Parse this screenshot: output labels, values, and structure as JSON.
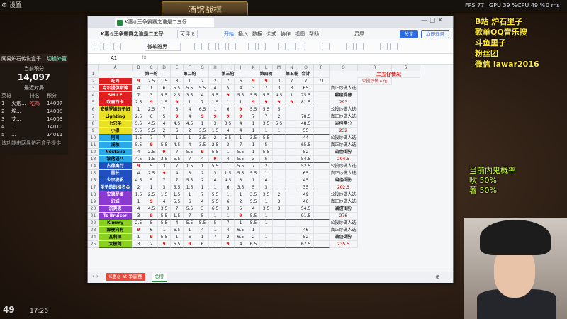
{
  "top": {
    "settings": "设置",
    "title": "酒馆战棋",
    "fps_label": "FPS",
    "fps": "77",
    "gpu_label": "GPU",
    "gpu": "39 %",
    "cpu_label": "CPU",
    "cpu": "49 %",
    "delay_label": "延迟",
    "delay": "0 ms"
  },
  "left_panel": {
    "name": "网易炉石传说盒子",
    "switch": "切换外置",
    "score_label": "当前积分",
    "score": "14,097",
    "recent": "最近对局",
    "col1": "英雄",
    "col2": "排名",
    "col3": "积分",
    "rows": [
      [
        "1",
        "火炮...",
        "吃鸡",
        "14097"
      ],
      [
        "2",
        "埃...",
        "",
        "14008"
      ],
      [
        "3",
        "艾...",
        "",
        "14003"
      ],
      [
        "4",
        "...",
        "",
        "14010"
      ],
      [
        "5",
        "...",
        "",
        "14011"
      ]
    ],
    "footer": "该功能由网易炉石盒子提供"
  },
  "window": {
    "tab": "K惠◎王争霸赛之谁是二五仔",
    "doc_title": "K惠◎王争霸赛之谁是二五仔",
    "quick_btn": "可评论",
    "menu": [
      "开始",
      "插入",
      "数据",
      "公式",
      "协作",
      "视图",
      "帮助"
    ],
    "share": "分享",
    "login": "立即登录",
    "people": "灵犀",
    "cell_ref": "A1",
    "font_name": "微软雅黑",
    "sheet_tabs": [
      "K惠◎ at 争霸赛",
      "总榜"
    ]
  },
  "grid": {
    "cols": [
      "A",
      "B",
      "C",
      "D",
      "E",
      "F",
      "G",
      "H",
      "I",
      "J",
      "K",
      "L",
      "M",
      "N",
      "O",
      "P",
      "Q",
      "R",
      "S",
      "T"
    ],
    "round_headers": [
      "第一轮",
      "第二轮",
      "第三轮",
      "第四轮",
      "第五轮",
      "合计",
      "",
      "二五仔情况"
    ],
    "rows": [
      [
        "吃鸡",
        "9",
        "2.5",
        "1.5",
        "3",
        "1",
        "2",
        "2",
        "7",
        "6",
        "9",
        "9",
        "3",
        "7",
        "7",
        "71",
        "",
        "公投炒做人选"
      ],
      [
        "克尔提伊斯钟",
        "4",
        "1",
        "6",
        "5.5",
        "5.5",
        "5.5",
        "4",
        "5",
        "4",
        "3",
        "7",
        "3",
        "3",
        "65",
        "",
        "真正炒做人选"
      ],
      [
        "SMILE",
        "7",
        "3",
        "5.5",
        "2.5",
        "3.5",
        "4",
        "5.5",
        "9",
        "5.5",
        "5.5",
        "5.5",
        "4.5",
        "1",
        "75.5",
        "",
        "最佳得分"
      ],
      [
        "吹鹿西卡",
        "2.5",
        "9",
        "1.5",
        "9",
        "1",
        "7",
        "1.5",
        "1",
        "1",
        "9",
        "9",
        "9",
        "9",
        "81.5",
        "",
        "293"
      ],
      [
        "安德罗姬的子妇",
        "1",
        "2.5",
        "7",
        "3",
        "4",
        "6.5",
        "1",
        "6",
        "9",
        "5.5",
        "5.5",
        "5",
        "",
        "",
        "",
        "公投炒做人选"
      ],
      [
        "Lighting",
        "2.5",
        "6",
        "5",
        "9",
        "4",
        "9",
        "9",
        "9",
        "9",
        "7",
        "7",
        "2",
        "",
        "78.5",
        "",
        "真正炒做人选"
      ],
      [
        "七只羊",
        "5.5",
        "4.5",
        "4",
        "4.5",
        "4.5",
        "1",
        "3",
        "3.5",
        "4",
        "1",
        "3.5",
        "5.5",
        "",
        "48.5",
        "",
        "最佳得分"
      ],
      [
        "小狼",
        "5.5",
        "5.5",
        "2",
        "6",
        "2",
        "3.5",
        "1.5",
        "4",
        "4",
        "1",
        "1",
        "1",
        "",
        "55",
        "",
        "232"
      ],
      [
        "阿司",
        "1.5",
        "7",
        "7",
        "1",
        "1",
        "3.5",
        "2",
        "5.5",
        "1",
        "3.5",
        "5.5",
        "",
        "",
        "44",
        "",
        "公投炒做人选"
      ],
      [
        "浅秋",
        "5.5",
        "9",
        "5.5",
        "4.5",
        "4",
        "3.5",
        "2.5",
        "3",
        "7",
        "1",
        "5",
        "",
        "",
        "65.5",
        "",
        "真正炒做人选"
      ],
      [
        "Nostalie",
        "4",
        "2.5",
        "9",
        "7",
        "5.5",
        "9",
        "5.5",
        "1",
        "5.5",
        "1",
        "5.5",
        "",
        "",
        "52",
        "",
        "最佳得分"
      ],
      [
        "漆落语八",
        "4.5",
        "1.5",
        "3.5",
        "5.5",
        "7",
        "4",
        "9",
        "4",
        "5.5",
        "3",
        "5",
        "",
        "",
        "54.5",
        "",
        "204.5"
      ],
      [
        "古德奥行",
        "9",
        "5",
        "3",
        "7",
        "1.5",
        "1",
        "5.5",
        "1",
        "5.5",
        "7",
        "2",
        "",
        "",
        "52.5",
        "",
        "公投炒做人选"
      ],
      [
        "雷长",
        "4",
        "2.5",
        "9",
        "4",
        "3",
        "2",
        "3",
        "1.5",
        "5.5",
        "5.5",
        "1",
        "",
        "",
        "65",
        "",
        "真正炒做人选"
      ],
      [
        "少宗祝帆",
        "4.5",
        "5",
        "7",
        "7",
        "5.5",
        "2",
        "4",
        "4.5",
        "3",
        "1",
        "4",
        "",
        "",
        "45",
        "",
        "最佳得分"
      ],
      [
        "至子的的招名金",
        "2",
        "1",
        "3",
        "5.5",
        "1.5",
        "1",
        "1",
        "6",
        "3.5",
        "5",
        "3",
        "",
        "",
        "35",
        "",
        "202.5"
      ],
      [
        "安德罗姬",
        "1.5",
        "2.5",
        "1.5",
        "1.5",
        "1",
        "7",
        "5.5",
        "1",
        "1",
        "3.5",
        "3.5",
        "2",
        "",
        "49",
        "",
        "公投炒做人选"
      ],
      [
        "幻城",
        "1",
        "9",
        "4",
        "5.5",
        "6",
        "4",
        "5.5",
        "6",
        "2",
        "5.5",
        "1",
        "3",
        "",
        "46",
        "",
        "真正炒做人选"
      ],
      [
        "沉笑思",
        "4",
        "4.5",
        "3.5",
        "7",
        "5.5",
        "3",
        "6.5",
        "3",
        "5",
        "4",
        "3.5",
        "3",
        "",
        "54.5",
        "",
        "最佳得分"
      ],
      [
        "Ts Bruiser",
        "3",
        "9",
        "5.5",
        "1.5",
        "7",
        "5",
        "1",
        "1",
        "9",
        "5.5",
        "1",
        "",
        "",
        "91.5",
        "",
        "276"
      ],
      [
        "Kimmy",
        "2.5",
        "5",
        "5.5",
        "4",
        "5.5",
        "5.5",
        "5",
        "7",
        "1",
        "5.5",
        "1",
        "",
        "",
        "",
        "",
        "公投炒做人选"
      ],
      [
        "那梗向有",
        "9",
        "6",
        "1",
        "6.5",
        "1",
        "4",
        "1",
        "4",
        "6.5",
        "1",
        "",
        "",
        "",
        "46",
        "",
        "真正炒做人选"
      ],
      [
        "瓦莉拉",
        "1",
        "9",
        "5.5",
        "1",
        "6",
        "1",
        "7",
        "2",
        "6.5",
        "2",
        "1",
        "",
        "",
        "52",
        "",
        "最佳得分"
      ],
      [
        "太极剑",
        "3",
        "2",
        "9",
        "6.5",
        "9",
        "6",
        "1",
        "9",
        "4",
        "6.5",
        "1",
        "",
        "",
        "67.5",
        "",
        "235.5"
      ]
    ],
    "group_summary": [
      [
        "胖嘟胖嘟",
        "293"
      ],
      [
        "抖音",
        "232"
      ],
      [
        "斗鱼1队",
        "204.5"
      ],
      [
        "斗鱼2队",
        "202.5"
      ],
      [
        "虎牙1队",
        "276"
      ],
      [
        "虎牙2队",
        "235.5"
      ]
    ]
  },
  "overlay": {
    "line1": "B站 炉石里子",
    "line2": "歌单QQ音乐搜",
    "line3": "斗鱼里子",
    "line4": "粉丝团",
    "line5": "微信 lawar2016",
    "prob_title": "当前内鬼概率",
    "prob1": "吹 50%",
    "prob2": "薯 50%"
  },
  "bottombar": {
    "count": "49",
    "time": "17:26"
  },
  "colors": {
    "red": "#e02020",
    "green": "#1e8c3a",
    "blue": "#2e6be6",
    "yellow": "#ffe83a"
  }
}
